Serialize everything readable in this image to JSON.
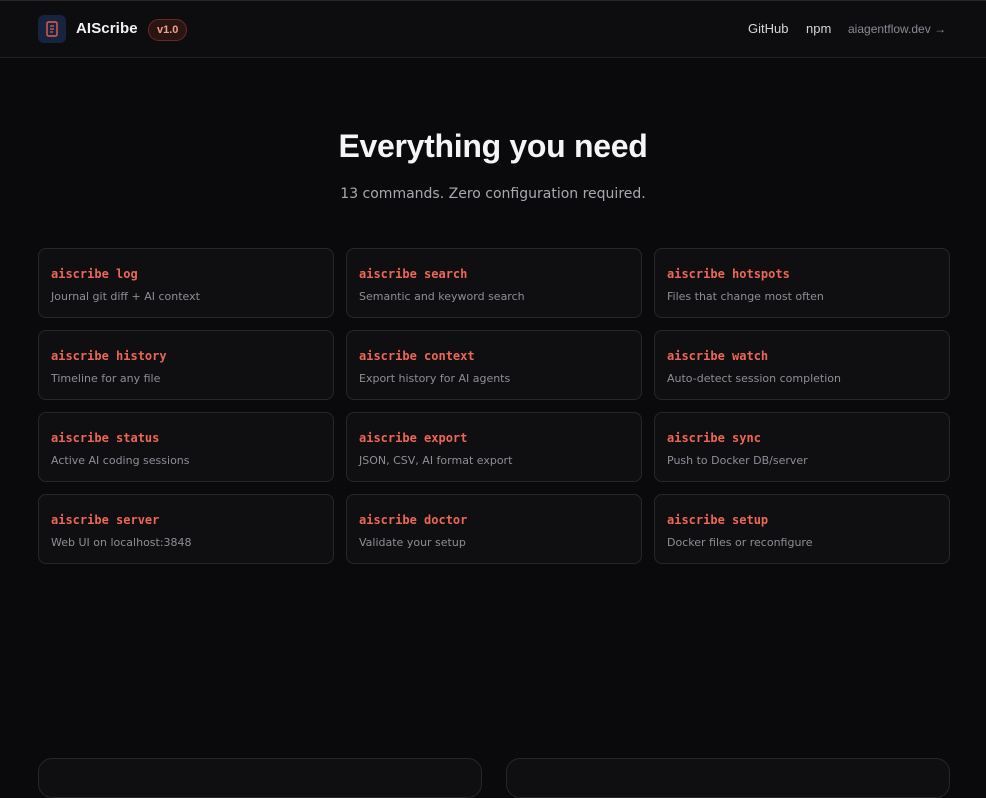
{
  "header": {
    "brand": "AIScribe",
    "version": "v1.0",
    "logo_icon": "scroll-icon",
    "nav": {
      "github": "GitHub",
      "npm": "npm",
      "site": "aiagentflow.dev →"
    }
  },
  "hero": {
    "title": "Everything you need",
    "subtitle": "13 commands. Zero configuration required."
  },
  "commands": [
    {
      "cmd": "aiscribe log",
      "desc": "Journal git diff + AI context"
    },
    {
      "cmd": "aiscribe search",
      "desc": "Semantic and keyword search"
    },
    {
      "cmd": "aiscribe hotspots",
      "desc": "Files that change most often"
    },
    {
      "cmd": "aiscribe history",
      "desc": "Timeline for any file"
    },
    {
      "cmd": "aiscribe context",
      "desc": "Export history for AI agents"
    },
    {
      "cmd": "aiscribe watch",
      "desc": "Auto-detect session completion"
    },
    {
      "cmd": "aiscribe status",
      "desc": "Active AI coding sessions"
    },
    {
      "cmd": "aiscribe export",
      "desc": "JSON, CSV, AI format export"
    },
    {
      "cmd": "aiscribe sync",
      "desc": "Push to Docker DB/server"
    },
    {
      "cmd": "aiscribe server",
      "desc": "Web UI on localhost:3848"
    },
    {
      "cmd": "aiscribe doctor",
      "desc": "Validate your setup"
    },
    {
      "cmd": "aiscribe setup",
      "desc": "Docker files or reconfigure"
    }
  ],
  "colors": {
    "accent": "#ee6655",
    "background": "#0a0a0c",
    "card": "#0f0f12"
  }
}
